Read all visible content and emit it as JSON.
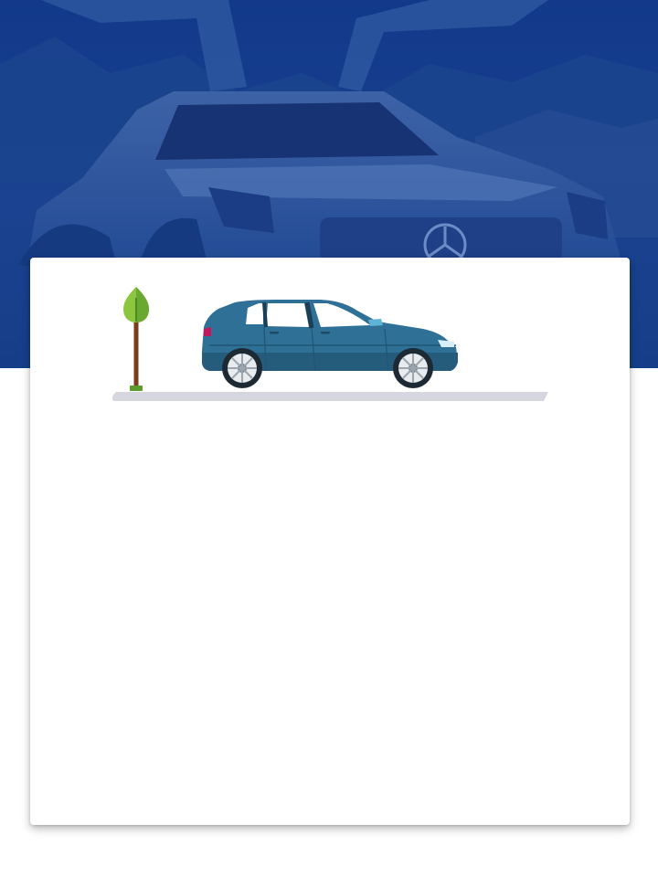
{
  "hero": {
    "background_color": "#153c86",
    "image_icon": "sports-car-gullwing-photo"
  },
  "card": {
    "background_color": "#ffffff",
    "illustration": {
      "tree_icon": "tree-icon",
      "car_icon": "hatchback-car-icon",
      "car_color": "#2f7196",
      "leaf_color": "#8cc63f",
      "road_color": "#d6d6df"
    }
  }
}
